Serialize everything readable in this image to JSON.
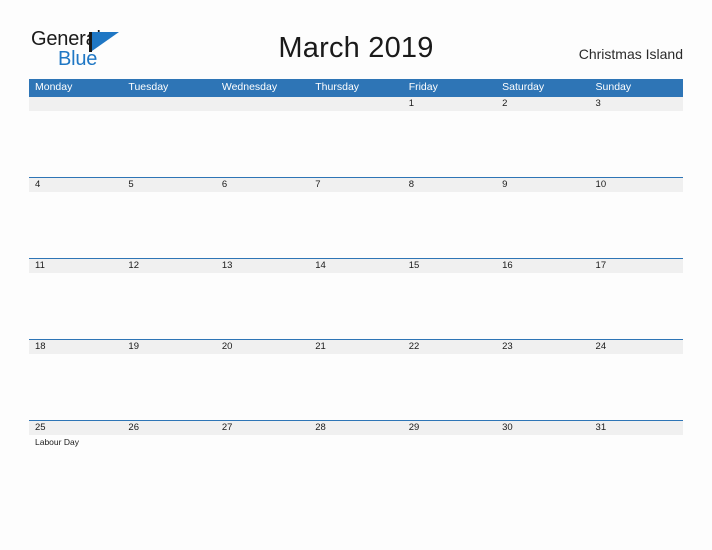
{
  "brand": {
    "word_one": "General",
    "word_two": "Blue",
    "flag_color": "#1f77c4",
    "pole_color": "#1a1a1a"
  },
  "header": {
    "title": "March 2019",
    "locale": "Christmas Island"
  },
  "theme": {
    "header_blue": "#2e75b6",
    "row_separator": "#2e75b6",
    "number_strip": "#f0f0f0",
    "page_background": "#fdfdfd",
    "text": "#1a1a1a",
    "dow_text": "#ffffff"
  },
  "calendar": {
    "day_headers": [
      "Monday",
      "Tuesday",
      "Wednesday",
      "Thursday",
      "Friday",
      "Saturday",
      "Sunday"
    ],
    "weeks": [
      {
        "days": [
          {
            "number": "",
            "event": ""
          },
          {
            "number": "",
            "event": ""
          },
          {
            "number": "",
            "event": ""
          },
          {
            "number": "",
            "event": ""
          },
          {
            "number": "1",
            "event": ""
          },
          {
            "number": "2",
            "event": ""
          },
          {
            "number": "3",
            "event": ""
          }
        ]
      },
      {
        "days": [
          {
            "number": "4",
            "event": ""
          },
          {
            "number": "5",
            "event": ""
          },
          {
            "number": "6",
            "event": ""
          },
          {
            "number": "7",
            "event": ""
          },
          {
            "number": "8",
            "event": ""
          },
          {
            "number": "9",
            "event": ""
          },
          {
            "number": "10",
            "event": ""
          }
        ]
      },
      {
        "days": [
          {
            "number": "11",
            "event": ""
          },
          {
            "number": "12",
            "event": ""
          },
          {
            "number": "13",
            "event": ""
          },
          {
            "number": "14",
            "event": ""
          },
          {
            "number": "15",
            "event": ""
          },
          {
            "number": "16",
            "event": ""
          },
          {
            "number": "17",
            "event": ""
          }
        ]
      },
      {
        "days": [
          {
            "number": "18",
            "event": ""
          },
          {
            "number": "19",
            "event": ""
          },
          {
            "number": "20",
            "event": ""
          },
          {
            "number": "21",
            "event": ""
          },
          {
            "number": "22",
            "event": ""
          },
          {
            "number": "23",
            "event": ""
          },
          {
            "number": "24",
            "event": ""
          }
        ]
      },
      {
        "days": [
          {
            "number": "25",
            "event": "Labour Day"
          },
          {
            "number": "26",
            "event": ""
          },
          {
            "number": "27",
            "event": ""
          },
          {
            "number": "28",
            "event": ""
          },
          {
            "number": "29",
            "event": ""
          },
          {
            "number": "30",
            "event": ""
          },
          {
            "number": "31",
            "event": ""
          }
        ]
      }
    ]
  }
}
